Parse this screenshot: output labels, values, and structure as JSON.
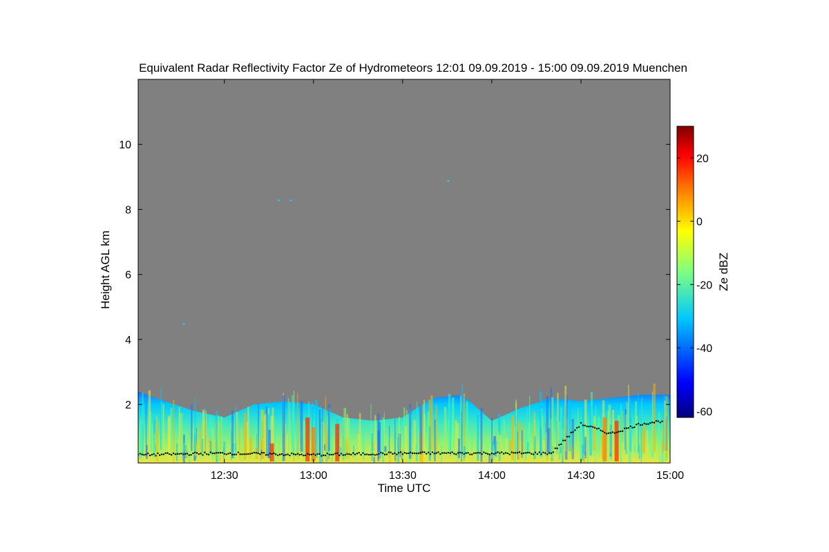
{
  "chart_data": {
    "type": "heatmap",
    "title": "Equivalent Radar Reflectivity Factor Ze of Hydrometeors   12:01 09.09.2019 - 15:00 09.09.2019 Muenchen",
    "xlabel": "Time UTC",
    "ylabel": "Height AGL km",
    "x_range": [
      "12:01",
      "15:00"
    ],
    "y_range_km": [
      0.2,
      12.0
    ],
    "x_ticks": [
      "12:30",
      "13:00",
      "13:30",
      "14:00",
      "14:30",
      "15:00"
    ],
    "y_ticks": [
      "2",
      "4",
      "6",
      "8",
      "10"
    ],
    "colorbar": {
      "label": "Ze dBZ",
      "range": [
        -62,
        30
      ],
      "ticks": [
        "-60",
        "-40",
        "-20",
        "0",
        "20"
      ],
      "colormap": "jet"
    },
    "background_color": "#808080",
    "cloud_echo_top_profile_km": {
      "times": [
        "12:01",
        "12:10",
        "12:20",
        "12:30",
        "12:40",
        "12:50",
        "13:00",
        "13:10",
        "13:20",
        "13:30",
        "13:40",
        "13:50",
        "14:00",
        "14:10",
        "14:20",
        "14:30",
        "14:40",
        "14:50",
        "15:00"
      ],
      "top_km": [
        2.4,
        2.1,
        1.8,
        1.6,
        2.0,
        2.1,
        2.0,
        1.6,
        1.5,
        1.6,
        2.2,
        2.3,
        1.5,
        1.9,
        2.2,
        2.1,
        2.2,
        2.3,
        2.3
      ]
    },
    "ceilometer_cloud_base_km": {
      "times": [
        "12:01",
        "12:30",
        "13:00",
        "13:30",
        "14:00",
        "14:20",
        "14:30",
        "14:40",
        "14:50",
        "14:58"
      ],
      "base_km": [
        0.45,
        0.5,
        0.45,
        0.5,
        0.5,
        0.5,
        1.4,
        1.1,
        1.4,
        1.5
      ]
    },
    "isolated_echoes": [
      {
        "time": "12:48",
        "height_km": 8.3
      },
      {
        "time": "12:52",
        "height_km": 8.3
      },
      {
        "time": "13:45",
        "height_km": 8.9
      },
      {
        "time": "12:16",
        "height_km": 4.5
      }
    ]
  }
}
